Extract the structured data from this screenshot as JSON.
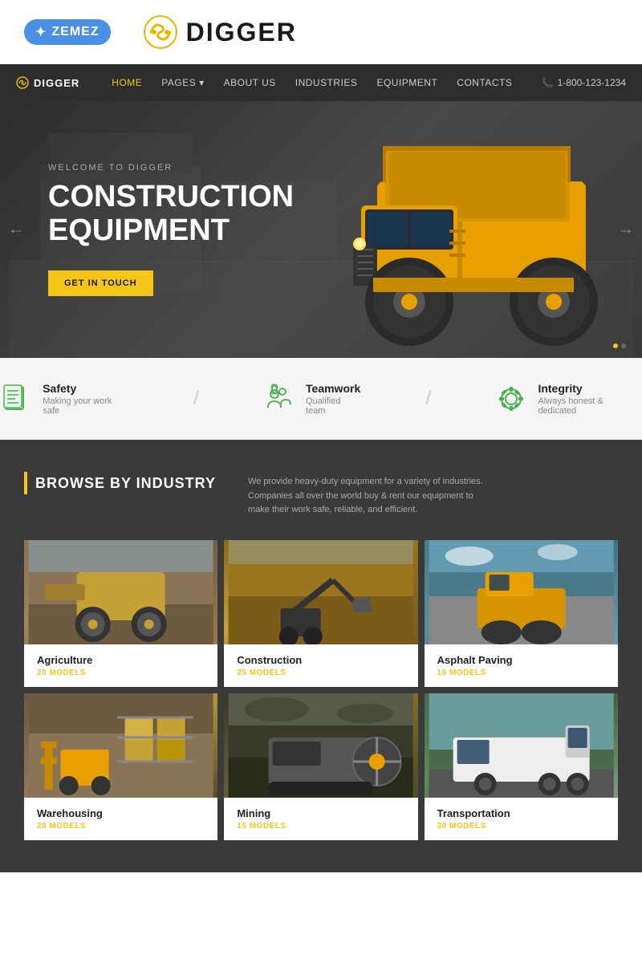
{
  "brand_bar": {
    "zemez_label": "ZEMEZ",
    "digger_label": "DIGGER"
  },
  "navbar": {
    "logo": "DIGGER",
    "links": [
      {
        "label": "HOME",
        "active": true,
        "has_dropdown": false
      },
      {
        "label": "PAGES",
        "active": false,
        "has_dropdown": true
      },
      {
        "label": "ABOUT US",
        "active": false,
        "has_dropdown": false
      },
      {
        "label": "INDUSTRIES",
        "active": false,
        "has_dropdown": false
      },
      {
        "label": "EQUIPMENT",
        "active": false,
        "has_dropdown": false
      },
      {
        "label": "CONTACTS",
        "active": false,
        "has_dropdown": false
      }
    ],
    "phone": "1-800-123-1234"
  },
  "hero": {
    "subtitle": "WELCOME TO DIGGER",
    "title": "CONSTRUCTION\nEQUIPMENT",
    "cta_button": "GET IN TOUCH",
    "arrow_left": "←",
    "arrow_right": "→"
  },
  "features": [
    {
      "icon": "safety-icon",
      "title": "Safety",
      "description": "Making your work safe"
    },
    {
      "icon": "teamwork-icon",
      "title": "Teamwork",
      "description": "Qualified team"
    },
    {
      "icon": "integrity-icon",
      "title": "Integrity",
      "description": "Always honest & dedicated"
    }
  ],
  "browse": {
    "section_title": "BROWSE BY INDUSTRY",
    "description": "We provide heavy-duty equipment for a variety of industries. Companies all over the world buy & rent our equipment to make their work safe, reliable, and efficient."
  },
  "industries": [
    {
      "name": "Agriculture",
      "models": "20 MODELS",
      "img_class": "img-agriculture"
    },
    {
      "name": "Construction",
      "models": "25 MODELS",
      "img_class": "img-construction"
    },
    {
      "name": "Asphalt Paving",
      "models": "10 MODELS",
      "img_class": "img-asphalt"
    },
    {
      "name": "Warehousing",
      "models": "28 MODELS",
      "img_class": "img-warehousing"
    },
    {
      "name": "Mining",
      "models": "15 MODELS",
      "img_class": "img-mining"
    },
    {
      "name": "Transportation",
      "models": "30 MODELS",
      "img_class": "img-transportation"
    }
  ]
}
